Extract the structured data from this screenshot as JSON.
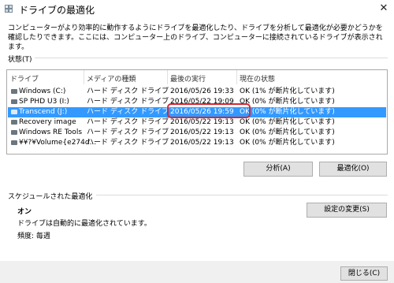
{
  "window": {
    "title": "ドライブの最適化",
    "close_glyph": "✕"
  },
  "description": "コンピューターがより効率的に動作するようにドライブを最適化したり、ドライブを分析して最適化が必要かどうかを確認したりできます。ここには、コンピューター上のドライブ、コンピューターに接続されているドライブが表示されます。",
  "status_section": {
    "label": "状態(T)",
    "columns": [
      "ドライブ",
      "メディアの種類",
      "最後の実行",
      "現在の状態"
    ],
    "drives": [
      {
        "name": "Windows (C:)",
        "media": "ハード ディスク ドライブ",
        "last_run": "2016/05/26 19:33",
        "status": "OK (1% が断片化しています)",
        "selected": false
      },
      {
        "name": "SP PHD U3 (I:)",
        "media": "ハード ディスク ドライブ",
        "last_run": "2016/05/22 19:09",
        "status": "OK (0% が断片化しています)",
        "selected": false
      },
      {
        "name": "Transcend (J:)",
        "media": "ハード ディスク ドライブ",
        "last_run": "2016/05/26 19:59",
        "status": "OK (0% が断片化しています)",
        "selected": true
      },
      {
        "name": "Recovery image",
        "media": "ハード ディスク ドライブ",
        "last_run": "2016/05/22 19:13",
        "status": "OK (0% が断片化しています)",
        "selected": false
      },
      {
        "name": "Windows RE Tools",
        "media": "ハード ディスク ドライブ",
        "last_run": "2016/05/22 19:13",
        "status": "OK (0% が断片化しています)",
        "selected": false
      },
      {
        "name": "¥¥?¥Volume{e274d...",
        "media": "ハード ディスク ドライブ",
        "last_run": "2016/05/22 19:13",
        "status": "OK (0% が断片化しています)",
        "selected": false
      }
    ],
    "analyze_label": "分析(A)",
    "optimize_label": "最適化(O)"
  },
  "schedule_section": {
    "label": "スケジュールされた最適化",
    "state": "オン",
    "info": "ドライブは自動的に最適化されています。",
    "frequency": "頻度: 毎週",
    "change_settings_label": "設定の変更(S)"
  },
  "footer": {
    "close_label": "閉じる(C)"
  },
  "colors": {
    "selection": "#3399ff",
    "highlight_box": "#d22a35"
  }
}
